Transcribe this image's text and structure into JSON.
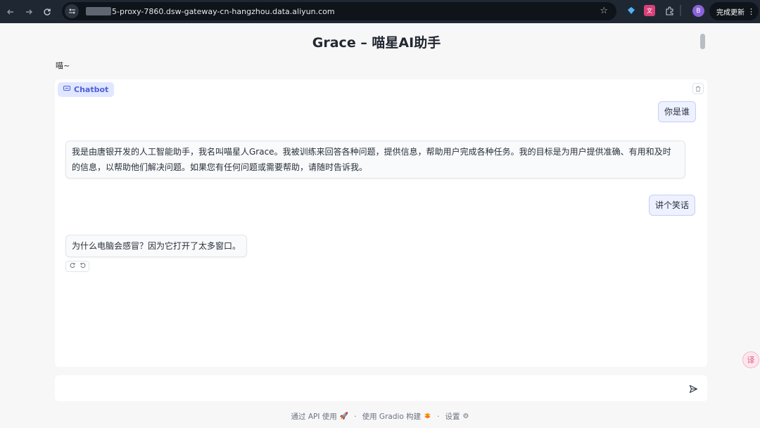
{
  "browser": {
    "url": "5-proxy-7860.dsw-gateway-cn-hangzhou.data.aliyun.com",
    "profile_initial": "B",
    "update_label": "完成更新"
  },
  "page": {
    "title": "Grace – 喵星AI助手",
    "subtitle": "喵~"
  },
  "chatbot": {
    "label": "Chatbot",
    "messages": [
      {
        "role": "user",
        "text": "你是谁"
      },
      {
        "role": "bot",
        "text": "我是由唐银开发的人工智能助手，我名叫喵星人Grace。我被训练来回答各种问题，提供信息，帮助用户完成各种任务。我的目标是为用户提供准确、有用和及时的信息，以帮助他们解决问题。如果您有任何问题或需要帮助，请随时告诉我。"
      },
      {
        "role": "user",
        "text": "讲个笑话"
      },
      {
        "role": "bot",
        "text": "为什么电脑会感冒？因为它打开了太多窗口。"
      }
    ]
  },
  "input": {
    "value": "",
    "placeholder": ""
  },
  "footer": {
    "api_label": "通过 API 使用",
    "gradio_label": "使用 Gradio 构建",
    "settings_label": "设置",
    "separator": "·"
  },
  "colors": {
    "chrome_bg": "#1f2733",
    "accent": "#4f5fd9",
    "user_bubble": "#eef1ff"
  }
}
